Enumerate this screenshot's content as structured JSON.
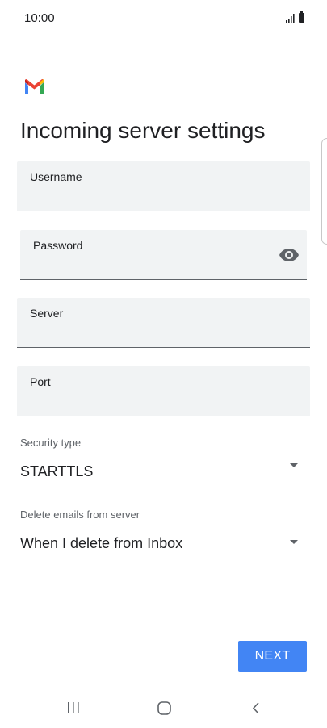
{
  "status_bar": {
    "time": "10:00"
  },
  "app": {
    "logo_icon": "gmail-logo-icon",
    "colors": {
      "red": "#ea4335",
      "blue": "#4285f4",
      "green": "#34a853",
      "yellow": "#fbbc04"
    }
  },
  "page": {
    "title": "Incoming server settings"
  },
  "fields": {
    "username": {
      "label": "Username",
      "value": ""
    },
    "password": {
      "label": "Password",
      "value": "",
      "toggle_icon": "eye-icon"
    },
    "server": {
      "label": "Server",
      "value": ""
    },
    "port": {
      "label": "Port",
      "value": ""
    }
  },
  "security_type": {
    "label": "Security type",
    "selected": "STARTTLS"
  },
  "delete_emails": {
    "label": "Delete emails from server",
    "selected": "When I delete from Inbox"
  },
  "actions": {
    "next_label": "NEXT",
    "accent": "#4285f4"
  },
  "nav_bar": {
    "recents_icon": "recents-icon",
    "home_icon": "home-icon",
    "back_icon": "back-icon"
  }
}
